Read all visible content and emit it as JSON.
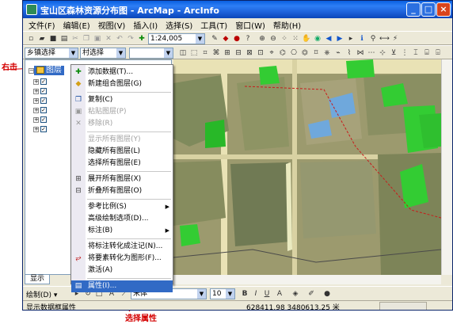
{
  "window": {
    "title": "宝山区森林资源分布图 - ArcMap - ArcInfo",
    "controls": [
      "_",
      "□",
      "×"
    ]
  },
  "menubar": [
    "文件(F)",
    "编辑(E)",
    "视图(V)",
    "插入(I)",
    "选择(S)",
    "工具(T)",
    "窗口(W)",
    "帮助(H)"
  ],
  "toolbar1": {
    "icons_left": [
      "new-doc",
      "open",
      "save",
      "print",
      "cut",
      "copy",
      "paste",
      "delete",
      "undo",
      "redo",
      "add-data"
    ],
    "scale": "1:24,005",
    "icons_right": [
      "editor",
      "arctoolbox",
      "arccatalog",
      "whats-this",
      "zoom-in",
      "zoom-out",
      "fixed-zoom-in",
      "fixed-zoom-out",
      "pan",
      "full-extent",
      "back",
      "forward",
      "select",
      "identify",
      "find",
      "measure",
      "hyperlink"
    ]
  },
  "toolbar2": {
    "dropdown1": "乡镇选择",
    "dropdown2": "村选择"
  },
  "toc": {
    "root_label": "图层",
    "tabs": [
      "显示"
    ]
  },
  "context_menu": {
    "items": [
      {
        "label": "添加数据(T)...",
        "icon": "add-data",
        "enabled": true
      },
      {
        "label": "新建组合图层(G)",
        "icon": "group-layer",
        "enabled": true
      },
      {
        "sep": true
      },
      {
        "label": "复制(C)",
        "icon": "copy",
        "enabled": true
      },
      {
        "label": "粘贴图层(P)",
        "icon": "paste",
        "enabled": false
      },
      {
        "label": "移除(R)",
        "icon": "remove",
        "enabled": false
      },
      {
        "sep": true
      },
      {
        "label": "显示所有图层(Y)",
        "enabled": false
      },
      {
        "label": "隐藏所有图层(L)",
        "enabled": true
      },
      {
        "label": "选择所有图层(E)",
        "enabled": true
      },
      {
        "sep": true
      },
      {
        "label": "展开所有图层(X)",
        "icon": "expand",
        "enabled": true
      },
      {
        "label": "折叠所有图层(O)",
        "icon": "collapse",
        "enabled": true
      },
      {
        "sep": true
      },
      {
        "label": "参考比例(S)",
        "submenu": true,
        "enabled": true
      },
      {
        "label": "高级绘制选项(D)...",
        "enabled": true
      },
      {
        "label": "标注(B)",
        "submenu": true,
        "enabled": true
      },
      {
        "sep": true
      },
      {
        "label": "将标注转化成注记(N)...",
        "enabled": true
      },
      {
        "label": "将要素转化为图形(F)...",
        "icon": "convert",
        "enabled": true
      },
      {
        "label": "激活(A)",
        "enabled": true
      },
      {
        "sep": true
      },
      {
        "label": "属性(I)...",
        "icon": "properties",
        "enabled": true,
        "highlighted": true
      }
    ]
  },
  "drawbar": {
    "draw_label": "绘制(D) ▾",
    "font": "宋体",
    "size": "10"
  },
  "statusbar": {
    "left_text": "显示数据框属性",
    "coords": "628411.98  3480613.25 米"
  },
  "annotations": {
    "right_click": "右击",
    "choose_props": "选择属性"
  },
  "colors": {
    "title_blue": "#1b5ed6",
    "selection_blue": "#316ac5",
    "annotation_red": "#d40000",
    "forest_green": "#33cc33",
    "water_blue": "#6fa8dc"
  }
}
